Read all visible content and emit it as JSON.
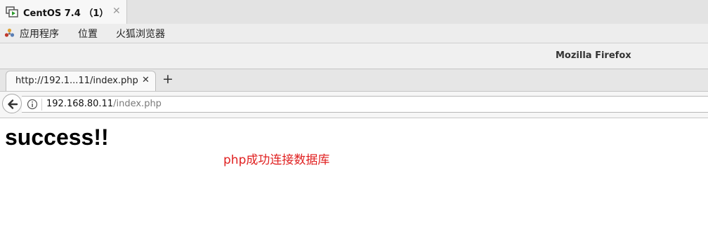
{
  "vm_window": {
    "tab_title": "CentOS 7.4 （1）",
    "close_glyph": "✕",
    "tab_icon": "vm-play-icon"
  },
  "gnome_bar": {
    "items": [
      {
        "label": "应用程序",
        "icon": "apps-icon"
      },
      {
        "label": "位置"
      },
      {
        "label": "火狐浏览器"
      }
    ]
  },
  "browser": {
    "window_title": "Mozilla Firefox",
    "tab": {
      "title": "http://192.1...11/index.php",
      "close_glyph": "✕"
    },
    "new_tab_glyph": "+",
    "urlbar": {
      "host": "192.168.80.11",
      "path": "/index.php",
      "info_icon": "info-icon"
    }
  },
  "page": {
    "heading": "success!!",
    "note": "php成功连接数据库",
    "note_color": "#e02020"
  }
}
